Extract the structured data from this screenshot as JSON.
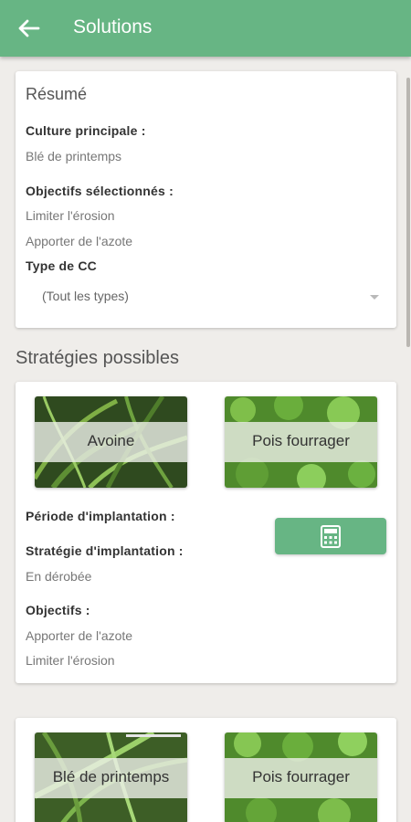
{
  "appbar": {
    "title": "Solutions",
    "back_icon": "arrow-left-icon",
    "color": "#67b584"
  },
  "summary": {
    "title": "Résumé",
    "main_crop_label": "Culture principale :",
    "main_crop_value": "Blé de printemps",
    "objectives_label": "Objectifs sélectionnés :",
    "objectives": [
      "Limiter l'érosion",
      "Apporter de l'azote"
    ],
    "cc_type_label": "Type de CC",
    "cc_type_selected": "(Tout les types)"
  },
  "strategies": {
    "section_title": "Stratégies possibles",
    "items": [
      {
        "crops": [
          "Avoine",
          "Pois fourrager"
        ],
        "period_label": "Période d'implantation :",
        "strategy_label": "Stratégie d'implantation :",
        "strategy_value": "En dérobée",
        "objectives_label": "Objectifs :",
        "objectives": [
          "Apporter de l'azote",
          "Limiter l'érosion"
        ],
        "calc_icon": "calculator-icon"
      },
      {
        "crops": [
          "Blé de printemps",
          "Pois fourrager"
        ]
      }
    ]
  }
}
